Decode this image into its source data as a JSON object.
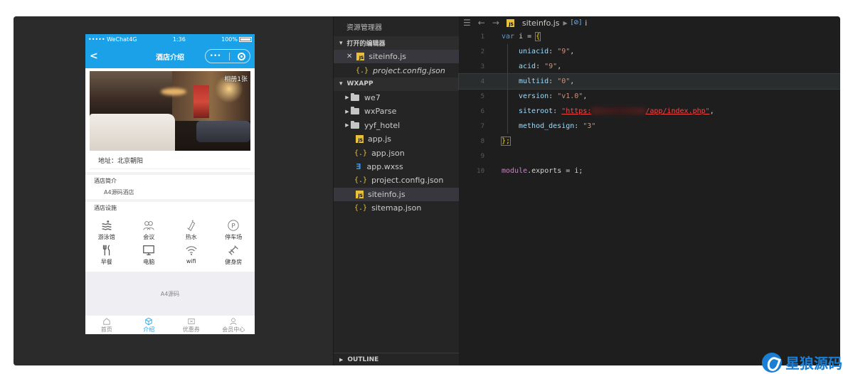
{
  "phone": {
    "status": {
      "carrier": "••••• WeChat4G",
      "time": "1:36",
      "battery": "100%"
    },
    "navbar": {
      "back": "<",
      "title": "酒店介绍",
      "menu": "•••"
    },
    "hero": {
      "counter": "相册1张"
    },
    "address": "地址：北京朝阳",
    "intro": {
      "label": "酒店简介",
      "text": "A4源码酒店"
    },
    "facilities": {
      "label": "酒店设施",
      "items": [
        {
          "label": "游泳馆",
          "icon": "swimming-icon"
        },
        {
          "label": "会议",
          "icon": "meeting-icon"
        },
        {
          "label": "热水",
          "icon": "hot-water-icon"
        },
        {
          "label": "停车场",
          "icon": "parking-icon"
        },
        {
          "label": "早餐",
          "icon": "breakfast-icon"
        },
        {
          "label": "电脑",
          "icon": "computer-icon"
        },
        {
          "label": "wifi",
          "icon": "wifi-icon"
        },
        {
          "label": "健身房",
          "icon": "gym-icon"
        }
      ]
    },
    "footer": "A4源码",
    "tabs": [
      {
        "label": "首页",
        "icon": "home-icon"
      },
      {
        "label": "介绍",
        "icon": "intro-icon"
      },
      {
        "label": "优惠券",
        "icon": "coupon-icon"
      },
      {
        "label": "会员中心",
        "icon": "member-icon"
      }
    ]
  },
  "explorer": {
    "title": "资源管理器",
    "open_editors": {
      "label": "打开的编辑器",
      "items": [
        {
          "name": "siteinfo.js",
          "type": "js",
          "close": "✕"
        },
        {
          "name": "project.config.json",
          "type": "json"
        }
      ]
    },
    "project": {
      "label": "WXAPP",
      "items": [
        {
          "name": "we7",
          "type": "folder"
        },
        {
          "name": "wxParse",
          "type": "folder"
        },
        {
          "name": "yyf_hotel",
          "type": "folder"
        },
        {
          "name": "app.js",
          "type": "js"
        },
        {
          "name": "app.json",
          "type": "json"
        },
        {
          "name": "app.wxss",
          "type": "css"
        },
        {
          "name": "project.config.json",
          "type": "json"
        },
        {
          "name": "siteinfo.js",
          "type": "js"
        },
        {
          "name": "sitemap.json",
          "type": "json"
        }
      ]
    },
    "outline": "OUTLINE"
  },
  "editor": {
    "breadcrumb": {
      "file": "siteinfo.js",
      "symbol": "i"
    },
    "lines": [
      {
        "n": "1"
      },
      {
        "n": "2"
      },
      {
        "n": "3"
      },
      {
        "n": "4"
      },
      {
        "n": "5"
      },
      {
        "n": "6"
      },
      {
        "n": "7"
      },
      {
        "n": "8"
      },
      {
        "n": "9"
      },
      {
        "n": "10"
      }
    ],
    "code": {
      "l1_kw": "var",
      "l1_rest": " i = ",
      "l1_brace": "{",
      "l2_key": "uniacid",
      "l2_val": "\"9\"",
      "l3_key": "acid",
      "l3_val": "\"9\"",
      "l4_key": "multiid",
      "l4_val": "\"0\"",
      "l5_key": "version",
      "l5_val": "\"v1.0\"",
      "l6_key": "siteroot",
      "l6_val_a": "\"https:",
      "l6_val_b": "/app/index.php\"",
      "l7_key": "method_design",
      "l7_val": "\"3\"",
      "l8": "};",
      "l10_obj": "module",
      "l10_rest": ".exports = i;"
    }
  },
  "watermark": "星狼源码",
  "colors": {
    "accent": "#1aa1e8",
    "editor_bg": "#1e1e1e",
    "sidebar_bg": "#252526"
  }
}
